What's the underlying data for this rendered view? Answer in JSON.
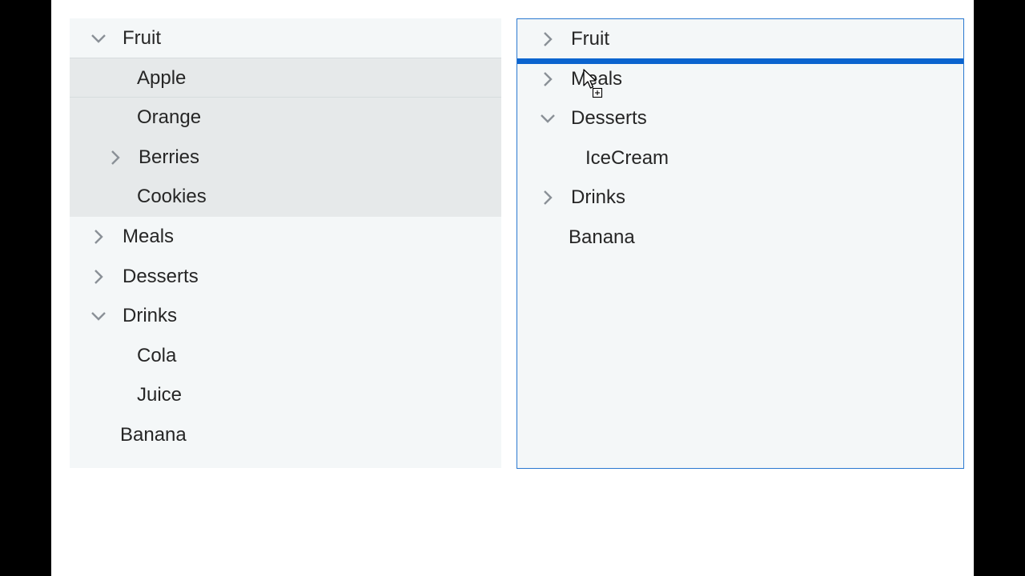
{
  "left_tree": {
    "nodes": [
      {
        "label": "Fruit",
        "expander": "expanded"
      },
      {
        "label": "Apple"
      },
      {
        "label": "Orange"
      },
      {
        "label": "Berries",
        "expander": "collapsed"
      },
      {
        "label": "Cookies"
      },
      {
        "label": "Meals",
        "expander": "collapsed"
      },
      {
        "label": "Desserts",
        "expander": "collapsed"
      },
      {
        "label": "Drinks",
        "expander": "expanded"
      },
      {
        "label": "Cola"
      },
      {
        "label": "Juice"
      },
      {
        "label": "Banana"
      }
    ]
  },
  "right_tree": {
    "nodes": [
      {
        "label": "Fruit",
        "expander": "collapsed"
      },
      {
        "label": "Meals",
        "expander": "collapsed"
      },
      {
        "label": "Desserts",
        "expander": "expanded"
      },
      {
        "label": "IceCream"
      },
      {
        "label": "Drinks",
        "expander": "collapsed"
      },
      {
        "label": "Banana"
      }
    ],
    "drop_indicator_after": "Fruit"
  },
  "colors": {
    "tree_bg": "#f4f7f8",
    "selected_row_bg": "#e6e9ea",
    "drop_indicator": "#0b64cf",
    "focus_border": "#2a78d0",
    "text": "#262626",
    "chevron": "#8a9097"
  },
  "icons": {
    "expanded": "chevron-down-icon",
    "collapsed": "chevron-right-icon",
    "cursor": "drag-copy-cursor-icon"
  }
}
